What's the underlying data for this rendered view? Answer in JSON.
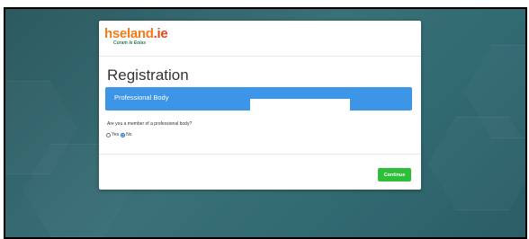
{
  "header": {
    "logo_hse": "hse",
    "logo_land": "land",
    "logo_ie": ".ie",
    "logo_tagline": "Cúram le Eolas"
  },
  "page": {
    "title": "Registration"
  },
  "section": {
    "label": "Professional Body"
  },
  "form": {
    "question": "Are you a member of a professional body?",
    "options": [
      {
        "label": "Yes",
        "checked": false
      },
      {
        "label": "No",
        "checked": true
      }
    ]
  },
  "actions": {
    "continue_label": "Continue"
  },
  "colors": {
    "accent_blue": "#3d95e8",
    "continue_green": "#2ebf3a",
    "logo_orange": "#f07c1b",
    "background_teal": "#3a7078"
  }
}
